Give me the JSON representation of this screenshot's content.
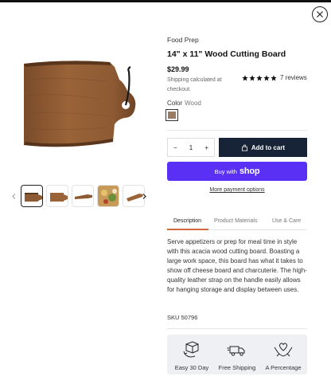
{
  "product": {
    "category": "Food Prep",
    "title": "14\" x 11\" Wood Cutting Board",
    "price": "$29.99",
    "shipping_note": "Shipping calculated at checkout.",
    "rating": 5,
    "reviews": "7 reviews",
    "color_label": "Color",
    "color_value": "Wood",
    "sku": "SKU 50796"
  },
  "purchase": {
    "quantity": "1",
    "minus": "−",
    "plus": "+",
    "add_to_cart": "Add to cart",
    "buy_with": "Buy with",
    "shop": "shop",
    "more_payment": "More payment options"
  },
  "tabs": [
    {
      "label": "Description",
      "active": true
    },
    {
      "label": "Product Materials",
      "active": false
    },
    {
      "label": "Use & Care",
      "active": false
    }
  ],
  "description": "Serve appetizers or prep for meal time in style with this acacia wood cutting board. Boasting a large work space, this board has what it takes to show off cheese board and charcuterie. The high-quality leather strap on the handle easily allows for hanging storage and display between uses.",
  "features": [
    {
      "label": "Easy 30 Day",
      "icon": "box-return-icon"
    },
    {
      "label": "Free Shipping",
      "icon": "truck-icon"
    },
    {
      "label": "A Percentage",
      "icon": "heart-hands-icon"
    }
  ],
  "colors": {
    "add_to_cart_bg": "#172438",
    "shop_pay_bg": "#5a31f4",
    "tab_accent": "#d06a3a",
    "wood": "#9a7b65"
  }
}
